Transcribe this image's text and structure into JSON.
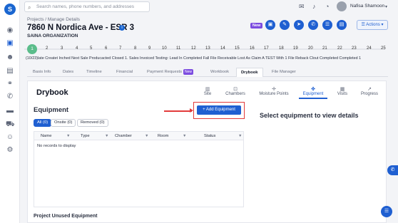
{
  "rail": {
    "logo": "S",
    "icons": [
      "globe-icon",
      "briefcase-icon",
      "people-icon",
      "map-icon",
      "handshake-icon",
      "phone-icon",
      "folder-icon",
      "truck-icon",
      "team-icon",
      "gear-icon"
    ]
  },
  "topbar": {
    "search_placeholder": "Search names, phone numbers, and addresses",
    "user_name": "Nafisa Shamoon"
  },
  "header": {
    "breadcrumb": "Projects / Manage Details",
    "title": "7860 N Nordica Ave - ESR 3",
    "organization": "SAINA ORGANIZATION",
    "new_badge": "New",
    "actions_label": "Actions"
  },
  "progress": {
    "active_step": "1",
    "steps": [
      "1",
      "2",
      "3",
      "4",
      "5",
      "6",
      "7",
      "8",
      "9",
      "10",
      "11",
      "12",
      "13",
      "14",
      "15",
      "16",
      "17",
      "18",
      "19",
      "20",
      "21",
      "22",
      "23",
      "24",
      "25"
    ],
    "stage_labels": "(10/23)late Createt Inched Next Sale Producacted Closed 1. Sales Invoiced Testing: Lead In Completed Fall File Receivable Lost As Claim A TEST With 1 File Reback Clout Completed Completed 1"
  },
  "tabs": [
    {
      "label": "Basis Info"
    },
    {
      "label": "Dates"
    },
    {
      "label": "Timeline"
    },
    {
      "label": "Financial"
    },
    {
      "label": "Payment Requests",
      "badge": "New"
    },
    {
      "label": "Workbook"
    },
    {
      "label": "Drybook"
    },
    {
      "label": "File Manager"
    }
  ],
  "drybook": {
    "title": "Drybook",
    "subtabs": [
      {
        "label": "Site",
        "icon": "building-icon"
      },
      {
        "label": "Chambers",
        "icon": "chamber-icon"
      },
      {
        "label": "Moisture Points",
        "icon": "target-icon"
      },
      {
        "label": "Equipment",
        "icon": "fan-icon"
      },
      {
        "label": "Visits",
        "icon": "calendar-icon"
      },
      {
        "label": "Progress",
        "icon": "chart-icon"
      }
    ],
    "section_title": "Equipment",
    "add_button": "+ Add Equipment",
    "select_message": "Select equipment to view details",
    "filters": [
      "All (0)",
      "Onsite (0)",
      "Removed (0)"
    ],
    "columns": [
      "Name",
      "Type",
      "Chamber",
      "Room",
      "Status"
    ],
    "empty_message": "No records to display",
    "unused_title": "Project Unused Equipment"
  }
}
